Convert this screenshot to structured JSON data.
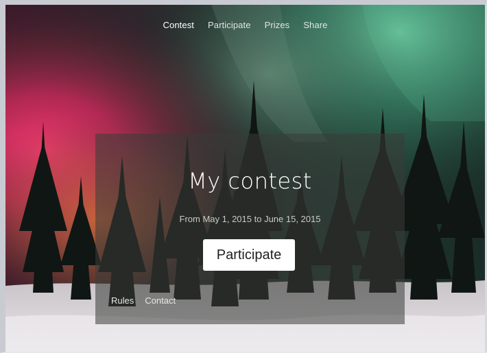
{
  "nav": {
    "items": [
      {
        "label": "Contest",
        "active": true
      },
      {
        "label": "Participate",
        "active": false
      },
      {
        "label": "Prizes",
        "active": false
      },
      {
        "label": "Share",
        "active": false
      }
    ]
  },
  "hero": {
    "title": "My contest",
    "dates": "From May 1, 2015 to June 15, 2015",
    "cta_label": "Participate",
    "footer_links": [
      "Rules",
      "Contact"
    ]
  },
  "colors": {
    "aurora_pink": "#e0306a",
    "aurora_green": "#4fae86",
    "card_overlay": "#3a3c38",
    "button_bg": "#ffffff"
  }
}
